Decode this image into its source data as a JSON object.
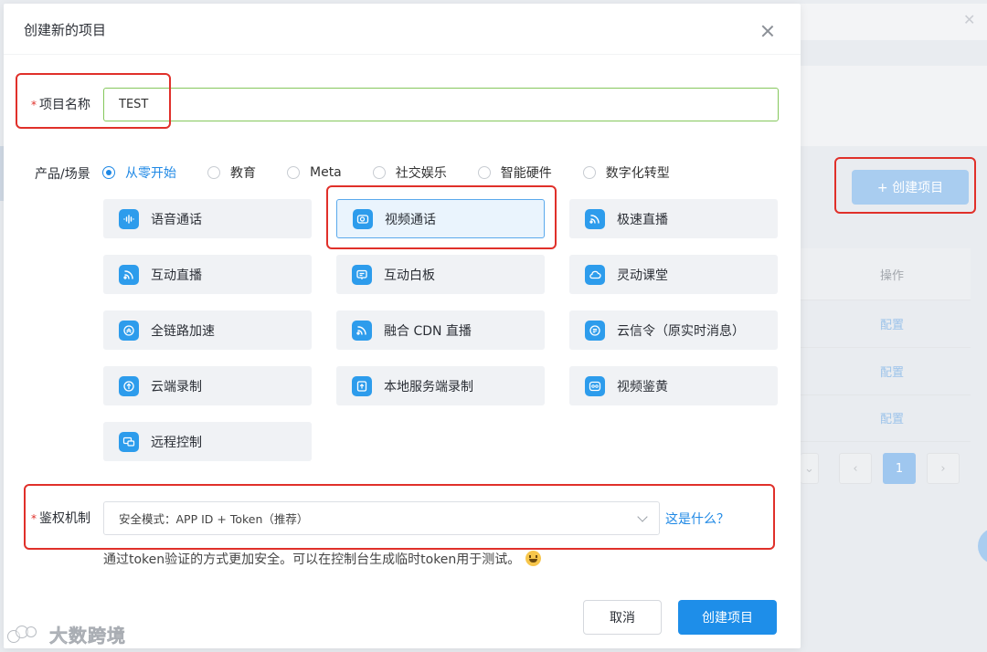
{
  "dialog": {
    "title": "创建新的项目"
  },
  "form": {
    "project_name_label": "项目名称",
    "project_name_value": "TEST",
    "scene_label": "产品/场景",
    "auth_label": "鉴权机制",
    "required_mark": "*"
  },
  "scenes": [
    {
      "label": "从零开始",
      "checked": true
    },
    {
      "label": "教育",
      "checked": false
    },
    {
      "label": "Meta",
      "checked": false
    },
    {
      "label": "社交娱乐",
      "checked": false
    },
    {
      "label": "智能硬件",
      "checked": false
    },
    {
      "label": "数字化转型",
      "checked": false
    }
  ],
  "products": [
    {
      "label": "语音通话",
      "icon": "voice-wave-icon"
    },
    {
      "label": "视频通话",
      "icon": "video-camera-icon",
      "selected": true
    },
    {
      "label": "极速直播",
      "icon": "broadcast-icon"
    },
    {
      "label": "互动直播",
      "icon": "live-broadcast-icon"
    },
    {
      "label": "互动白板",
      "icon": "whiteboard-icon"
    },
    {
      "label": "灵动课堂",
      "icon": "classroom-cloud-icon"
    },
    {
      "label": "全链路加速",
      "icon": "acceleration-icon"
    },
    {
      "label": "融合 CDN 直播",
      "icon": "cdn-live-icon"
    },
    {
      "label": "云信令（原实时消息）",
      "icon": "signaling-message-icon"
    },
    {
      "label": "云端录制",
      "icon": "cloud-recording-icon"
    },
    {
      "label": "本地服务端录制",
      "icon": "local-recording-icon"
    },
    {
      "label": "视频鉴黄",
      "icon": "content-moderation-icon"
    },
    {
      "label": "远程控制",
      "icon": "remote-control-icon"
    }
  ],
  "auth": {
    "selected": "安全模式：APP ID + Token（推荐）",
    "help_link": "这是什么？",
    "description": "通过token验证的方式更加安全。可以在控制台生成临时token用于测试。"
  },
  "footer": {
    "cancel_label": "取消",
    "create_label": "创建项目"
  },
  "background": {
    "create_button": "+ 创建项目",
    "op_header": "操作",
    "row_links": [
      "配置",
      "配置",
      "配置"
    ],
    "active_page": "1"
  },
  "watermark": {
    "text": "大数跨境"
  },
  "colors": {
    "primary": "#1e8ee9",
    "required": "#e0302a",
    "annotation_red": "#e0302a",
    "input_focus_green": "#85c75c"
  }
}
